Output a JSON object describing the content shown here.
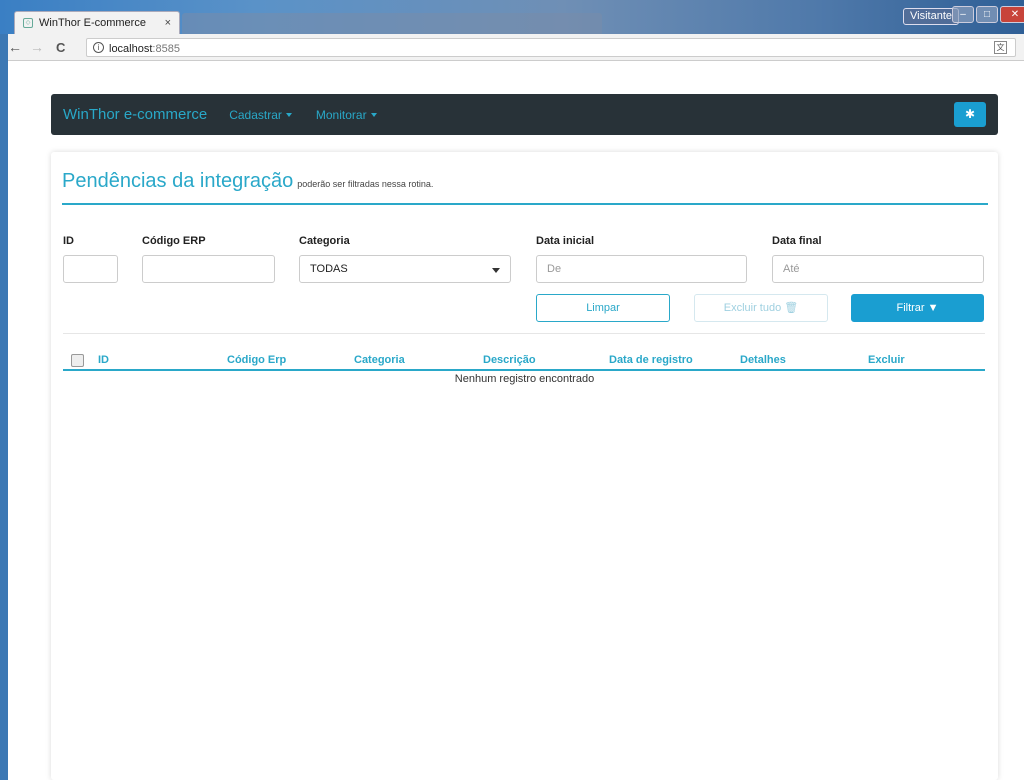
{
  "browser": {
    "tab_title": "WinThor E-commerce",
    "tab_close": "×",
    "profile_label": "Visitante",
    "url_host": "localhost",
    "url_port": ":8585",
    "nav_back": "←",
    "nav_forward": "→",
    "nav_reload": "C"
  },
  "navbar": {
    "brand": "WinThor e-commerce",
    "menu_register": "Cadastrar",
    "menu_monitor": "Monitorar"
  },
  "page": {
    "title": "Pendências da integração",
    "subtitle": "poderão ser filtradas nessa rotina."
  },
  "filters": {
    "id_label": "ID",
    "erp_label": "Código ERP",
    "category_label": "Categoria",
    "category_value": "TODAS",
    "start_label": "Data inicial",
    "start_placeholder": "De",
    "end_label": "Data final",
    "end_placeholder": "Até"
  },
  "buttons": {
    "clear": "Limpar",
    "delete_all": "Excluir tudo",
    "filter": "Filtrar"
  },
  "table": {
    "columns": [
      "ID",
      "Código Erp",
      "Categoria",
      "Descrição",
      "Data de registro",
      "Detalhes",
      "Excluir"
    ],
    "empty_message": "Nenhum registro encontrado"
  },
  "colors": {
    "accent": "#2aa8c9",
    "navbar_bg": "#283238",
    "primary_button": "#1a9ed1"
  }
}
